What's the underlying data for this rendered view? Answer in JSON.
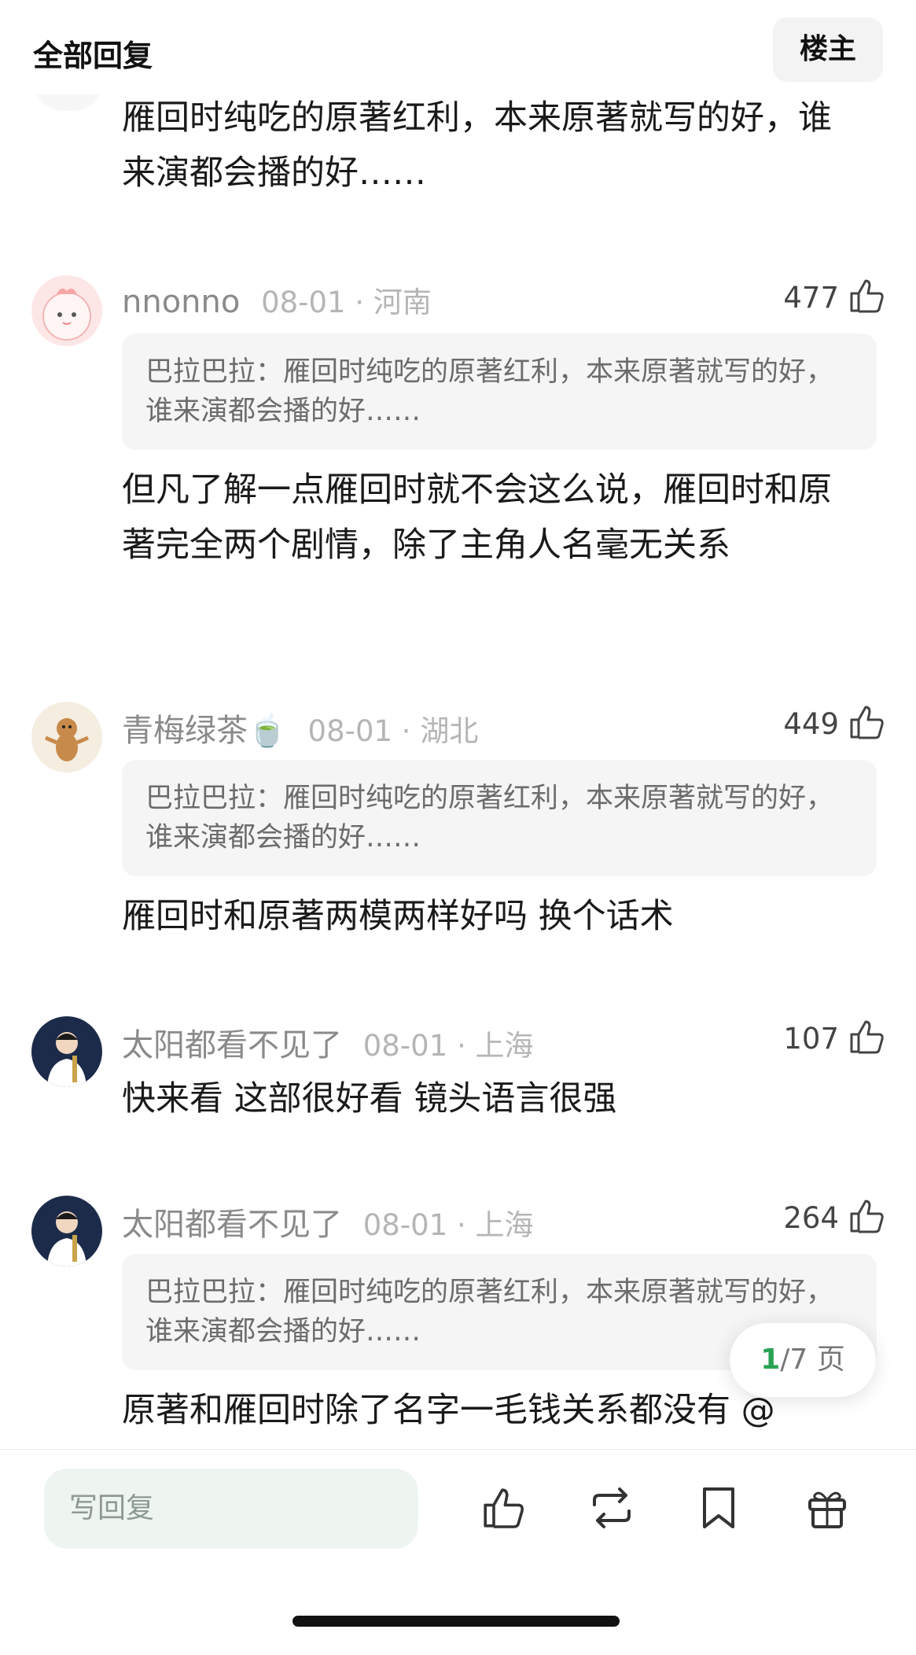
{
  "header": {
    "title": "全部回复",
    "owner_button": "楼主"
  },
  "top_partial_comment": {
    "text": "雁回时纯吃的原著红利，本来原著就写的好，谁来演都会播的好……"
  },
  "comments": [
    {
      "username": "nnonno",
      "date": "08-01 · 河南",
      "likes": "477",
      "quote": "巴拉巴拉：雁回时纯吃的原著红利，本来原著就写的好，谁来演都会播的好……",
      "text": "但凡了解一点雁回时就不会这么说，雁回时和原著完全两个剧情，除了主角人名毫无关系"
    },
    {
      "username": "青梅绿茶🍵",
      "date": "08-01 · 湖北",
      "likes": "449",
      "quote": "巴拉巴拉：雁回时纯吃的原著红利，本来原著就写的好，谁来演都会播的好……",
      "text": "雁回时和原著两模两样好吗 换个话术"
    },
    {
      "username": "太阳都看不见了",
      "date": "08-01 · 上海",
      "likes": "107",
      "text": "快来看 这部很好看 镜头语言很强"
    },
    {
      "username": "太阳都看不见了",
      "date": "08-01 · 上海",
      "likes": "264",
      "quote": "巴拉巴拉：雁回时纯吃的原著红利，本来原著就写的好，谁来演都会播的好……",
      "text": "原著和雁回时除了名字一毛钱关系都没有 @"
    }
  ],
  "pager": {
    "current": "1",
    "rest": "/7 页"
  },
  "bottom_bar": {
    "reply_placeholder": "写回复"
  },
  "icons": {
    "like": "thumbs-up-icon",
    "repost": "repost-icon",
    "bookmark": "bookmark-icon",
    "gift": "gift-icon"
  },
  "colors": {
    "accent_green": "#29a353",
    "reply_bg": "#eef4f0"
  }
}
